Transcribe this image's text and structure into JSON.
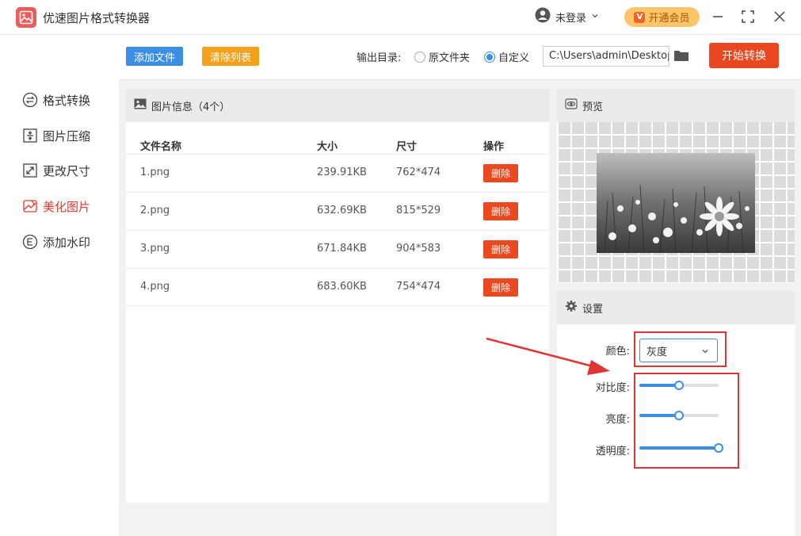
{
  "app": {
    "title": "优速图片格式转换器",
    "user_label": "未登录",
    "vip_label": "开通会员",
    "vip_badge": "V"
  },
  "sidebar": {
    "items": [
      {
        "label": "格式转换",
        "icon": "format-convert-icon",
        "active": false
      },
      {
        "label": "图片压缩",
        "icon": "compress-icon",
        "active": false
      },
      {
        "label": "更改尺寸",
        "icon": "resize-icon",
        "active": false
      },
      {
        "label": "美化图片",
        "icon": "beautify-icon",
        "active": true
      },
      {
        "label": "添加水印",
        "icon": "watermark-icon",
        "active": false
      }
    ]
  },
  "toolbar": {
    "add_label": "添加文件",
    "clear_label": "清除列表",
    "output_label": "输出目录:",
    "radio_original": "原文件夹",
    "radio_custom": "自定义",
    "selected_output": "custom",
    "path_value": "C:\\Users\\admin\\Desktop",
    "start_label": "开始转换"
  },
  "files": {
    "header": "图片信息（4个）",
    "columns": [
      "文件名称",
      "大小",
      "尺寸",
      "操作"
    ],
    "delete_label": "删除",
    "rows": [
      {
        "name": "1.png",
        "size": "239.91KB",
        "dim": "762*474"
      },
      {
        "name": "2.png",
        "size": "632.69KB",
        "dim": "815*529"
      },
      {
        "name": "3.png",
        "size": "671.84KB",
        "dim": "904*583"
      },
      {
        "name": "4.png",
        "size": "683.60KB",
        "dim": "754*474"
      }
    ]
  },
  "preview": {
    "title": "预览"
  },
  "settings": {
    "title": "设置",
    "color_label": "颜色:",
    "color_value": "灰度",
    "contrast_label": "对比度:",
    "contrast_value": 0.5,
    "brightness_label": "亮度:",
    "brightness_value": 0.5,
    "opacity_label": "透明度:",
    "opacity_value": 1.0
  },
  "colors": {
    "accent": "#3a8ee6",
    "danger": "#ea4820",
    "warning": "#f5a11c",
    "active_nav": "#e4392a"
  }
}
